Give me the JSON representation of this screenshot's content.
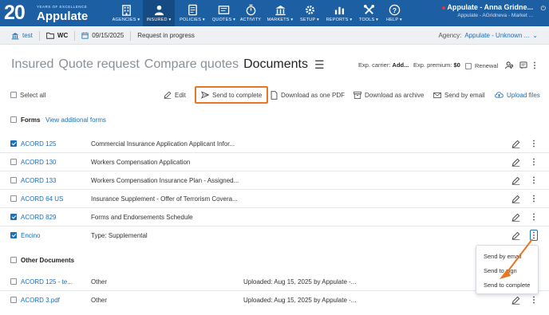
{
  "colors": {
    "nav_bg": "#1d5fa3",
    "accent": "#1d6fb8",
    "highlight": "#e87722"
  },
  "brand": {
    "years": "YEARS OF EXCELLENCE",
    "name": "Appulate",
    "number": "20"
  },
  "nav": [
    {
      "label": "AGENCIES",
      "icon": "agencies-icon"
    },
    {
      "label": "INSURED",
      "icon": "insured-icon"
    },
    {
      "label": "POLICIES",
      "icon": "policies-icon"
    },
    {
      "label": "QUOTES",
      "icon": "quotes-icon"
    },
    {
      "label": "ACTIVITY",
      "icon": "activity-icon"
    },
    {
      "label": "MARKETS",
      "icon": "markets-icon"
    },
    {
      "label": "SETUP",
      "icon": "setup-icon"
    },
    {
      "label": "REPORTS",
      "icon": "reports-icon"
    },
    {
      "label": "TOOLS",
      "icon": "tools-icon"
    },
    {
      "label": "HELP",
      "icon": "help-icon"
    }
  ],
  "user": {
    "name": "Appulate - Anna Gridne...",
    "sub": "Appulate - AGridneva - Market ..."
  },
  "subbar": {
    "insured": "test",
    "line": "WC",
    "date": "09/15/2025",
    "status": "Request in progress",
    "agency_label": "Agency:",
    "agency_value": "Appulate - Unknown ..."
  },
  "tabs": {
    "t1": "Insured",
    "t2": "Quote request",
    "t3": "Compare quotes",
    "t4": "Documents"
  },
  "exp": {
    "carrier_label": "Exp. carrier:",
    "carrier_value": "Add...",
    "premium_label": "Exp. premium:",
    "premium_value": "$0",
    "renewal": "Renewal"
  },
  "toolbar": {
    "select_all": "Select all",
    "edit": "Edit",
    "send_to_complete": "Send to complete",
    "download_pdf": "Download as one PDF",
    "download_archive": "Download as archive",
    "send_email": "Send by email",
    "upload": "Upload files"
  },
  "forms_section": {
    "title": "Forms",
    "link": "View additional forms"
  },
  "forms": [
    {
      "name": "ACORD 125",
      "desc": "Commercial Insurance Application Applicant Infor...",
      "checked": true
    },
    {
      "name": "ACORD 130",
      "desc": "Workers Compensation Application",
      "checked": false
    },
    {
      "name": "ACORD 133",
      "desc": "Workers Compensation Insurance Plan - Assigned...",
      "checked": false
    },
    {
      "name": "ACORD 64 US",
      "desc": "Insurance Supplement - Offer of Terrorism Covera...",
      "checked": false
    },
    {
      "name": "ACORD 829",
      "desc": "Forms and Endorsements Schedule",
      "checked": true
    },
    {
      "name": "Encino",
      "desc": "Type: Supplemental",
      "checked": true
    }
  ],
  "other_section": {
    "title": "Other Documents"
  },
  "other_docs": [
    {
      "name": "ACORD 125 - te...",
      "type": "Other",
      "uploaded": "Uploaded: Aug 15, 2025 by Appulate -..."
    },
    {
      "name": "ACORD 3.pdf",
      "type": "Other",
      "uploaded": "Uploaded: Aug 15, 2025 by Appulate -..."
    }
  ],
  "popup": {
    "item1": "Send by email",
    "item2": "Send to sign",
    "item3": "Send to complete"
  }
}
